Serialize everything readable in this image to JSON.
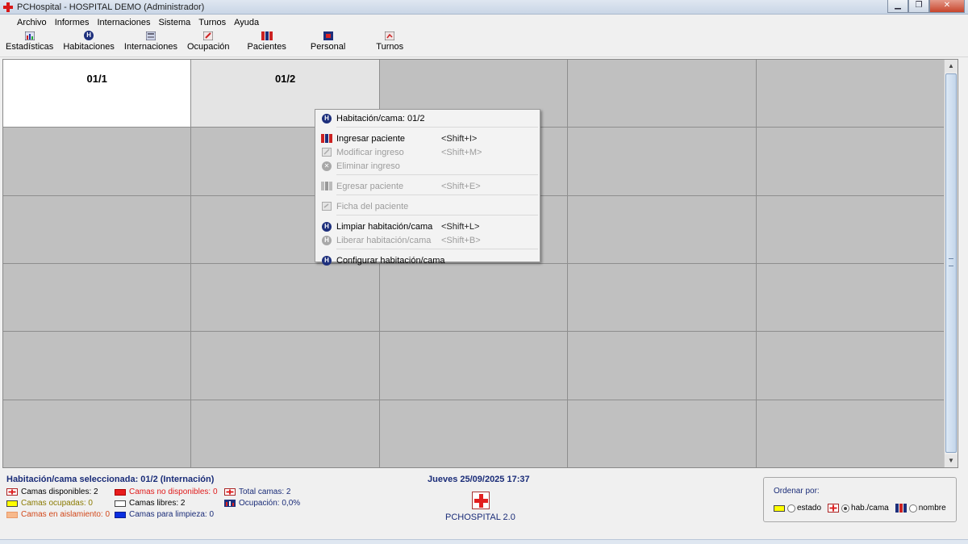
{
  "window": {
    "title": "PCHospital - HOSPITAL DEMO (Administrador)"
  },
  "menu": [
    "Archivo",
    "Informes",
    "Internaciones",
    "Sistema",
    "Turnos",
    "Ayuda"
  ],
  "toolbar": [
    {
      "label": "Estadísticas",
      "icon": "statistics-icon"
    },
    {
      "label": "Habitaciones",
      "icon": "rooms-icon"
    },
    {
      "label": "Internaciones",
      "icon": "hospitalization-icon"
    },
    {
      "label": "Ocupación",
      "icon": "occupation-icon"
    },
    {
      "label": "Pacientes",
      "icon": "patients-icon"
    },
    {
      "label": "Personal",
      "icon": "staff-icon"
    },
    {
      "label": "Turnos",
      "icon": "shifts-icon"
    }
  ],
  "grid": {
    "cells": [
      {
        "label": "01/1",
        "state": "white"
      },
      {
        "label": "01/2",
        "state": "light"
      }
    ]
  },
  "context_menu": {
    "header": "Habitación/cama: 01/2",
    "items": [
      {
        "label": "Ingresar paciente",
        "shortcut": "<Shift+I>",
        "enabled": true
      },
      {
        "label": "Modificar ingreso",
        "shortcut": "<Shift+M>",
        "enabled": false
      },
      {
        "label": "Eliminar ingreso",
        "shortcut": "",
        "enabled": false
      },
      {
        "label": "Egresar paciente",
        "shortcut": "<Shift+E>",
        "enabled": false
      },
      {
        "label": "Ficha del paciente",
        "shortcut": "",
        "enabled": false
      },
      {
        "label": "Limpiar habitación/cama",
        "shortcut": "<Shift+L>",
        "enabled": true
      },
      {
        "label": "Liberar habitación/cama",
        "shortcut": "<Shift+B>",
        "enabled": false
      },
      {
        "label": "Configurar habitación/cama",
        "shortcut": "",
        "enabled": true
      }
    ]
  },
  "status": {
    "selected": "Habitación/cama seleccionada: 01/2 (Internación)",
    "legend": {
      "disponibles": "Camas disponibles: 2",
      "ocupadas": "Camas ocupadas: 0",
      "aislamiento": "Camas en aislamiento: 0",
      "no_disponibles": "Camas no disponibles: 0",
      "libres": "Camas libres: 2",
      "limpieza": "Camas para limpieza: 0",
      "total": "Total camas: 2",
      "ocupacion": "Ocupación: 0,0%"
    },
    "colors": {
      "ocupadas": "#ffff00",
      "aislamiento": "#f7b98c",
      "no_disponibles": "#e81c1c",
      "libres": "#ffffff",
      "limpieza": "#0a2ee0"
    },
    "datetime": "Jueves 25/09/2025 17:37",
    "app_name": "PCHOSPITAL 2.0",
    "sort": {
      "title": "Ordenar por:",
      "options": [
        "estado",
        "hab./cama",
        "nombre"
      ],
      "selected": "hab./cama"
    }
  }
}
